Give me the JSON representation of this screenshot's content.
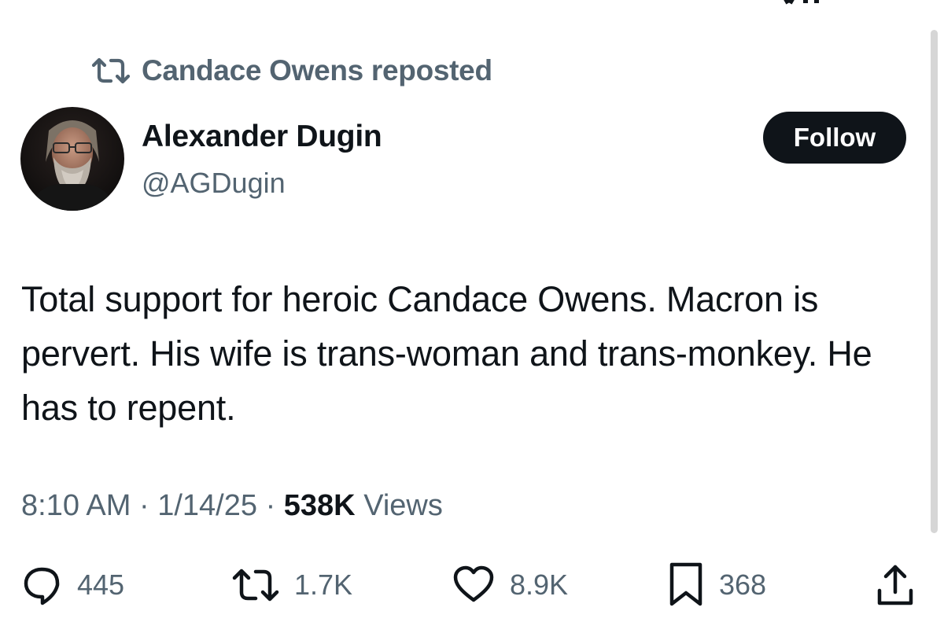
{
  "repost": {
    "label": "Candace Owens reposted",
    "icon": "repost-icon"
  },
  "author": {
    "name": "Alexander Dugin",
    "handle": "@AGDugin",
    "avatar": "avatar-photo"
  },
  "follow_button": {
    "label": "Follow"
  },
  "tweet": {
    "text": "Total support for heroic Candace Owens. Macron is pervert. His wife is trans-woman and trans-monkey. He has to repent."
  },
  "meta": {
    "time": "8:10 AM",
    "date": "1/14/25",
    "separator": "·",
    "views_count": "538K",
    "views_label": "Views"
  },
  "actions": {
    "replies": {
      "icon": "reply-icon",
      "count": "445"
    },
    "reposts": {
      "icon": "repost-icon",
      "count": "1.7K"
    },
    "likes": {
      "icon": "heart-icon",
      "count": "8.9K"
    },
    "bookmarks": {
      "icon": "bookmark-icon",
      "count": "368"
    },
    "share": {
      "icon": "share-icon"
    }
  },
  "colors": {
    "text_primary": "#0f1419",
    "text_secondary": "#536471",
    "button_bg": "#0f1419",
    "background": "#ffffff"
  }
}
